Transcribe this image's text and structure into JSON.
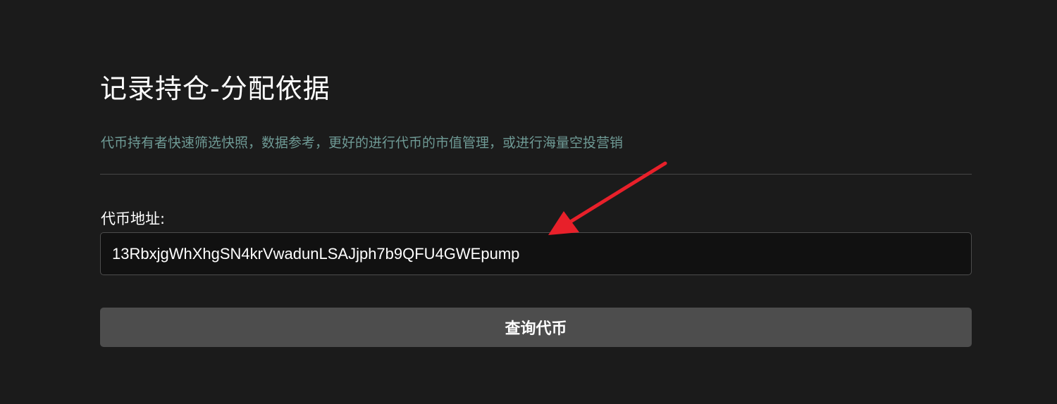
{
  "header": {
    "title": "记录持仓-分配依据",
    "subtitle": "代币持有者快速筛选快照，数据参考，更好的进行代币的市值管理，或进行海量空投营销"
  },
  "form": {
    "address_label": "代币地址:",
    "address_value": "13RbxjgWhXhgSN4krVwadunLSAJjph7b9QFU4GWEpump",
    "submit_label": "查询代币"
  },
  "annotation": {
    "arrow_color": "#e8202a"
  },
  "colors": {
    "background": "#1b1b1b",
    "subtitle": "#6f9a95",
    "button": "#4d4d4d"
  }
}
